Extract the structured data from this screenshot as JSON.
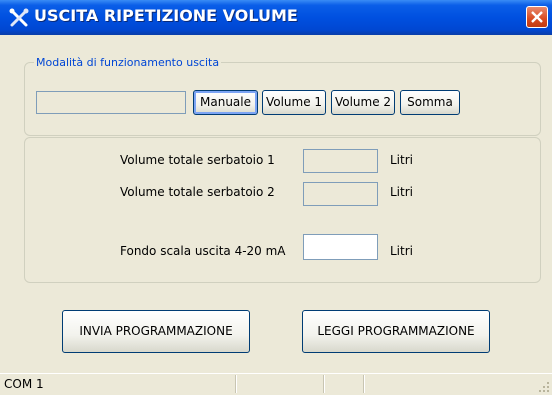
{
  "window": {
    "title": "USCITA RIPETIZIONE VOLUME",
    "title_icon": "tools-icon",
    "close_icon": "close-icon"
  },
  "mode_group": {
    "legend": "Modalità di funzionamento uscita",
    "current_mode_value": "",
    "buttons": {
      "manual": "Manuale",
      "volume1": "Volume 1",
      "volume2": "Volume 2",
      "sum": "Somma"
    }
  },
  "volumes": {
    "tank1_label": "Volume totale serbatoio 1",
    "tank1_value": "",
    "tank1_unit": "Litri",
    "tank2_label": "Volume totale serbatoio 2",
    "tank2_value": "",
    "tank2_unit": "Litri",
    "fullscale_label": "Fondo scala uscita 4-20 mA",
    "fullscale_value": "",
    "fullscale_unit": "Litri"
  },
  "actions": {
    "send": "INVIA PROGRAMMAZIONE",
    "read": "LEGGI PROGRAMMAZIONE"
  },
  "statusbar": {
    "port": "COM 1"
  },
  "colors": {
    "titlebar": "#0054e3",
    "window_bg": "#ece9d8",
    "legend_text": "#0046d5",
    "close_button": "#d84a20"
  }
}
